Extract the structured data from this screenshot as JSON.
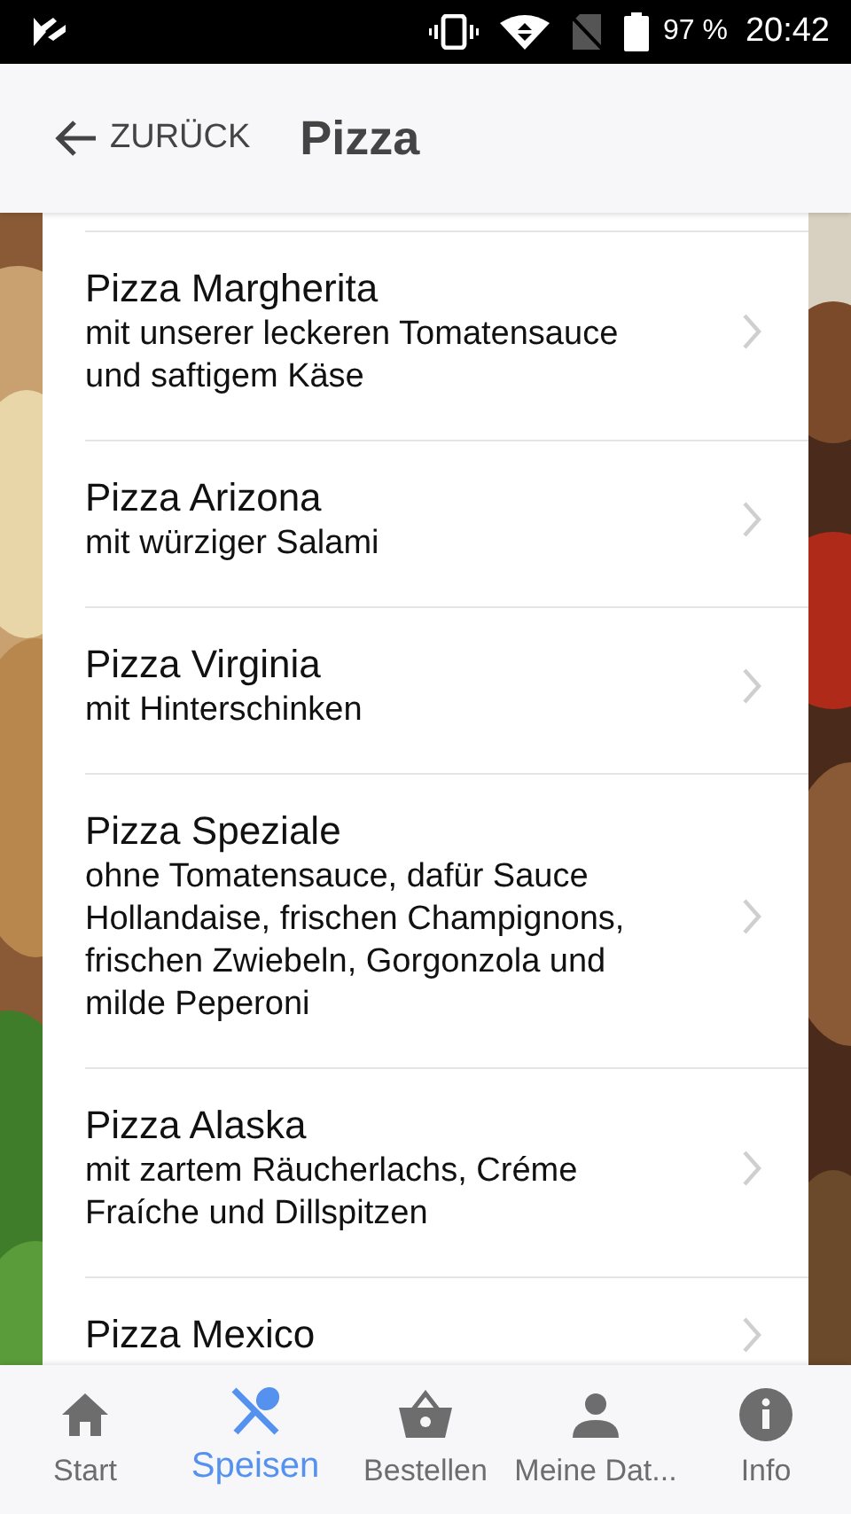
{
  "status_bar": {
    "battery": "97 %",
    "time": "20:42"
  },
  "header": {
    "back_label": "ZURÜCK",
    "title": "Pizza"
  },
  "items": [
    {
      "name": "Pizza Margherita",
      "description": "mit unserer leckeren Tomatensauce und saftigem Käse"
    },
    {
      "name": "Pizza Arizona",
      "description": "mit würziger Salami"
    },
    {
      "name": "Pizza Virginia",
      "description": "mit Hinterschinken"
    },
    {
      "name": "Pizza Speziale",
      "description": "ohne Tomatensauce, dafür Sauce Hollandaise, frischen Champignons, frischen Zwiebeln, Gorgonzola und milde Peperoni"
    },
    {
      "name": "Pizza Alaska",
      "description": "mit zartem Räucherlachs, Créme Fraíche und Dillspitzen"
    },
    {
      "name": "Pizza Mexico"
    }
  ],
  "tabs": [
    {
      "label": "Start",
      "selected": false
    },
    {
      "label": "Speisen",
      "selected": true
    },
    {
      "label": "Bestellen",
      "selected": false
    },
    {
      "label": "Meine Dat...",
      "selected": false
    },
    {
      "label": "Info",
      "selected": false
    }
  ]
}
